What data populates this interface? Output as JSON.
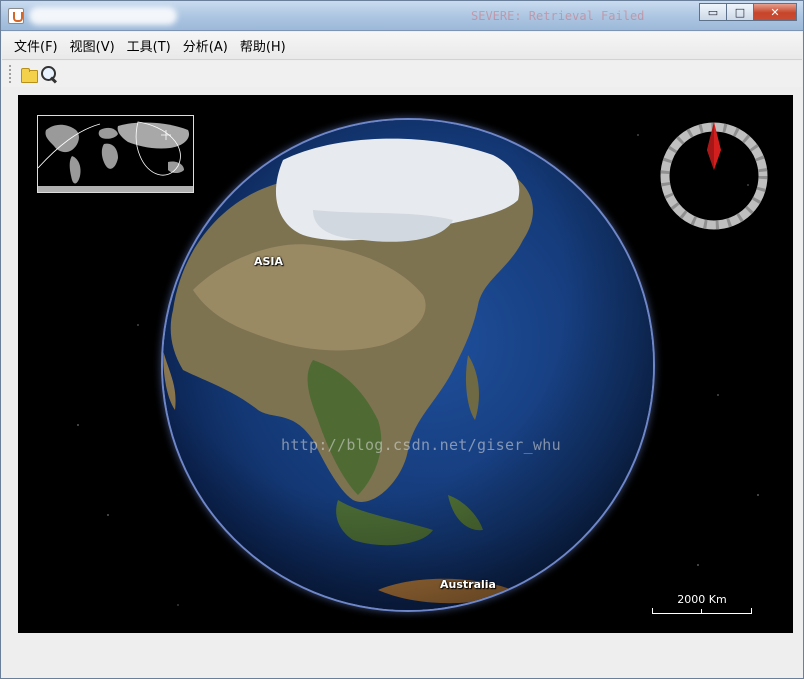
{
  "window": {
    "title": "",
    "buttons": {
      "minimize": "▭",
      "maximize": "□",
      "close": "✕"
    }
  },
  "background_text": "SEVERE: Retrieval Failed",
  "menu": {
    "items": [
      {
        "label": "文件(F)"
      },
      {
        "label": "视图(V)"
      },
      {
        "label": "工具(T)"
      },
      {
        "label": "分析(A)"
      },
      {
        "label": "帮助(H)"
      }
    ]
  },
  "toolbar": {
    "buttons": [
      {
        "icon": "folder-open-icon"
      },
      {
        "icon": "search-icon"
      }
    ]
  },
  "globe": {
    "labels": {
      "asia": "ASIA",
      "australia": "Australia"
    }
  },
  "scale": {
    "label": "2000 Km"
  },
  "watermark": "http://blog.csdn.net/giser_whu",
  "colors": {
    "space": "#000000",
    "ocean": "#163f85",
    "land": "#7b7050",
    "ice": "#e8ecf1",
    "compass_needle": "#d41f1f"
  }
}
